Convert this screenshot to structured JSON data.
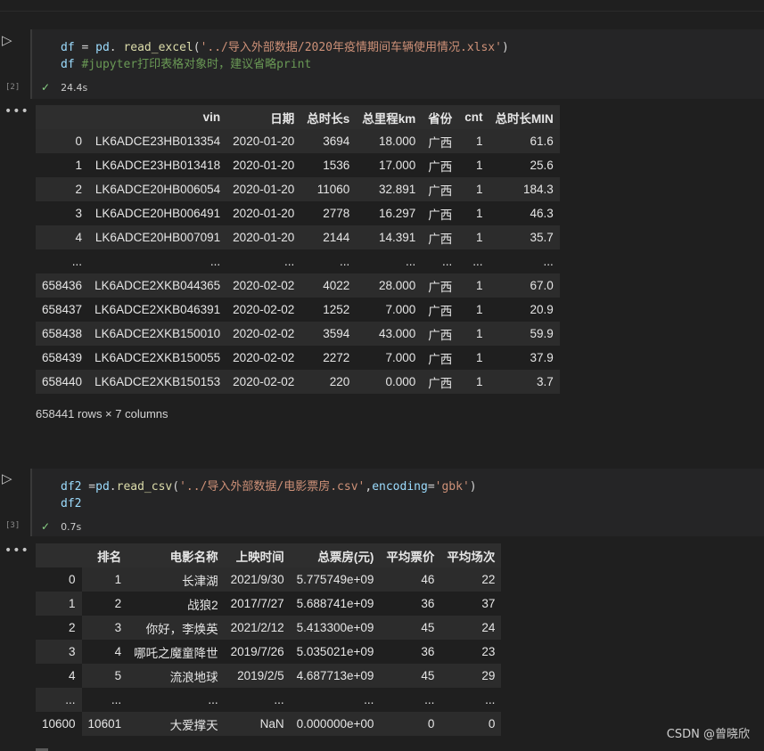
{
  "cell1": {
    "exec_count": "[2]",
    "code_line1": [
      {
        "t": "df",
        "c": "v"
      },
      {
        "t": " = ",
        "c": "p"
      },
      {
        "t": "pd",
        "c": "v"
      },
      {
        "t": ". ",
        "c": "p"
      },
      {
        "t": "read_excel",
        "c": "f"
      },
      {
        "t": "(",
        "c": "p"
      },
      {
        "t": "'../导入外部数据/2020年疫情期间车辆使用情况.xlsx'",
        "c": "s"
      },
      {
        "t": ")",
        "c": "p"
      }
    ],
    "code_line2": [
      {
        "t": "df ",
        "c": "v"
      },
      {
        "t": "#jupyter打印表格对象时，建议省略print",
        "c": "c"
      }
    ],
    "duration": "24.4s",
    "columns": [
      "",
      "vin",
      "日期",
      "总时长s",
      "总里程km",
      "省份",
      "cnt",
      "总时长MIN"
    ],
    "rows": [
      [
        "0",
        "LK6ADCE23HB013354",
        "2020-01-20",
        "3694",
        "18.000",
        "广西",
        "1",
        "61.6"
      ],
      [
        "1",
        "LK6ADCE23HB013418",
        "2020-01-20",
        "1536",
        "17.000",
        "广西",
        "1",
        "25.6"
      ],
      [
        "2",
        "LK6ADCE20HB006054",
        "2020-01-20",
        "11060",
        "32.891",
        "广西",
        "1",
        "184.3"
      ],
      [
        "3",
        "LK6ADCE20HB006491",
        "2020-01-20",
        "2778",
        "16.297",
        "广西",
        "1",
        "46.3"
      ],
      [
        "4",
        "LK6ADCE20HB007091",
        "2020-01-20",
        "2144",
        "14.391",
        "广西",
        "1",
        "35.7"
      ],
      [
        "...",
        "...",
        "...",
        "...",
        "...",
        "...",
        "...",
        "..."
      ],
      [
        "658436",
        "LK6ADCE2XKB044365",
        "2020-02-02",
        "4022",
        "28.000",
        "广西",
        "1",
        "67.0"
      ],
      [
        "658437",
        "LK6ADCE2XKB046391",
        "2020-02-02",
        "1252",
        "7.000",
        "广西",
        "1",
        "20.9"
      ],
      [
        "658438",
        "LK6ADCE2XKB150010",
        "2020-02-02",
        "3594",
        "43.000",
        "广西",
        "1",
        "59.9"
      ],
      [
        "658439",
        "LK6ADCE2XKB150055",
        "2020-02-02",
        "2272",
        "7.000",
        "广西",
        "1",
        "37.9"
      ],
      [
        "658440",
        "LK6ADCE2XKB150153",
        "2020-02-02",
        "220",
        "0.000",
        "广西",
        "1",
        "3.7"
      ]
    ],
    "shape": "658441 rows × 7 columns"
  },
  "cell2": {
    "exec_count": "[3]",
    "code_line1": [
      {
        "t": "df2",
        "c": "v"
      },
      {
        "t": " =",
        "c": "p"
      },
      {
        "t": "pd",
        "c": "v"
      },
      {
        "t": ".",
        "c": "p"
      },
      {
        "t": "read_csv",
        "c": "f"
      },
      {
        "t": "(",
        "c": "p"
      },
      {
        "t": "'../导入外部数据/电影票房.csv'",
        "c": "s"
      },
      {
        "t": ",",
        "c": "p"
      },
      {
        "t": "encoding",
        "c": "v"
      },
      {
        "t": "=",
        "c": "p"
      },
      {
        "t": "'gbk'",
        "c": "s"
      },
      {
        "t": ")",
        "c": "p"
      }
    ],
    "code_line2": [
      {
        "t": "df2",
        "c": "v"
      }
    ],
    "duration": "0.7s",
    "columns": [
      "",
      "排名",
      "电影名称",
      "上映时间",
      "总票房(元)",
      "平均票价",
      "平均场次"
    ],
    "rows": [
      [
        "0",
        "1",
        "长津湖",
        "2021/9/30",
        "5.775749e+09",
        "46",
        "22"
      ],
      [
        "1",
        "2",
        "战狼2",
        "2017/7/27",
        "5.688741e+09",
        "36",
        "37"
      ],
      [
        "2",
        "3",
        "你好，李焕英",
        "2021/2/12",
        "5.413300e+09",
        "45",
        "24"
      ],
      [
        "3",
        "4",
        "哪吒之魔童降世",
        "2019/7/26",
        "5.035021e+09",
        "36",
        "23"
      ],
      [
        "4",
        "5",
        "流浪地球",
        "2019/2/5",
        "4.687713e+09",
        "45",
        "29"
      ],
      [
        "...",
        "...",
        "...",
        "...",
        "...",
        "...",
        "..."
      ],
      [
        "10600",
        "10601",
        "大爱撑天",
        "NaN",
        "0.000000e+00",
        "0",
        "0"
      ]
    ]
  },
  "icons": {
    "run": "run-cell-icon",
    "check": "success-check-icon",
    "output_menu": "more-actions-icon"
  },
  "run_glyph": "▷",
  "check_glyph": "✓",
  "dots_glyph": "•••",
  "watermark": "CSDN @曾晓欣"
}
